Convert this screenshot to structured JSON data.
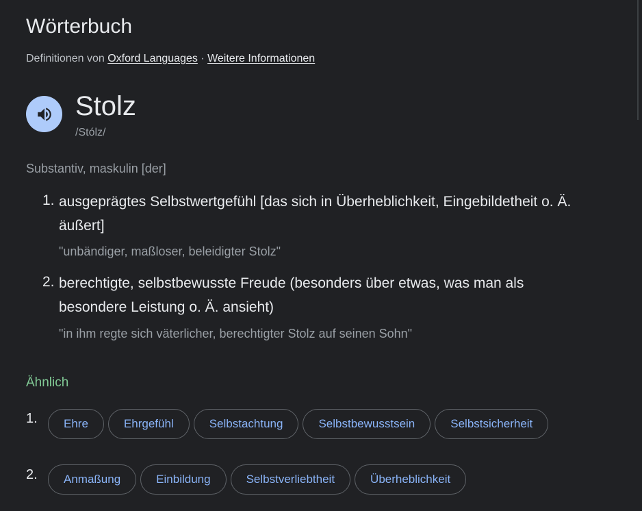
{
  "title": "Wörterbuch",
  "attribution": {
    "prefix": "Definitionen von",
    "source_link": "Oxford Languages",
    "separator": " · ",
    "more_link": "Weitere Informationen"
  },
  "entry": {
    "word": "Stolz",
    "phonetic": "/Stólz/",
    "part_of_speech": "Substantiv, maskulin [der]",
    "speaker_icon": "volume-up-icon"
  },
  "definitions": [
    {
      "number": "1.",
      "text": "ausgeprägtes Selbstwertgefühl [das sich in Überheblichkeit, Eingebildetheit o. Ä. äußert]",
      "example": "\"unbändiger, maßloser, beleidigter Stolz\""
    },
    {
      "number": "2.",
      "text": "berechtigte, selbstbewusste Freude (besonders über etwas, was man als besondere Leistung o. Ä. ansieht)",
      "example": "\"in ihm regte sich väterlicher, berechtigter Stolz auf seinen Sohn\""
    }
  ],
  "similar": {
    "heading": "Ähnlich",
    "groups": [
      {
        "number": "1.",
        "chips": [
          "Ehre",
          "Ehrgefühl",
          "Selbstachtung",
          "Selbstbewusstsein",
          "Selbstsicherheit"
        ]
      },
      {
        "number": "2.",
        "chips": [
          "Anmaßung",
          "Einbildung",
          "Selbstverliebtheit",
          "Überheblichkeit"
        ]
      }
    ]
  },
  "colors": {
    "background": "#202124",
    "text": "#e8eaed",
    "secondary_text": "#9aa0a6",
    "link_blue": "#8ab4f8",
    "speaker_bg": "#aecbfa",
    "similar_green": "#81c995",
    "chip_border": "#5f6368"
  }
}
